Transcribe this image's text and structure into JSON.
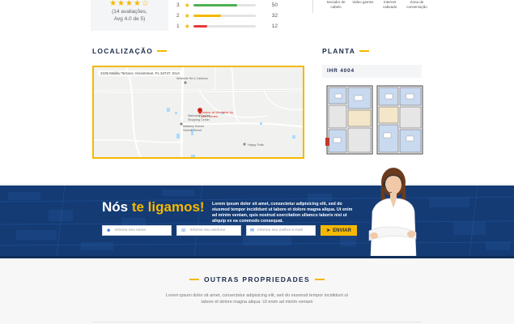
{
  "rating": {
    "stars": "★★★★☆",
    "count_text": "(14 avaliações,",
    "avg_text": "Avg 4.0 de 5)",
    "rows": [
      {
        "star_num": "3",
        "count": "50",
        "fill": 0.7,
        "color": "#4caf50"
      },
      {
        "star_num": "2",
        "count": "32",
        "fill": 0.45,
        "color": "#f5b800"
      },
      {
        "star_num": "1",
        "count": "12",
        "fill": 0.22,
        "color": "#e53935"
      }
    ]
  },
  "amenities": [
    {
      "label": "Secador de cabelo"
    },
    {
      "label": "Video games"
    },
    {
      "label": "Internet cabeado"
    },
    {
      "label": "Zona de conservação"
    }
  ],
  "localizacao": {
    "heading": "LOCALIZAÇÃO",
    "address": "2105 Malibu Terrace, Kissimmee, FL 34747, EUA",
    "pin_label": "Windsor at Westside by Patio Homes",
    "labels": [
      "Westside Rd & Calderon",
      "Walmarts Garden Shopping Center",
      "Mattamy Homes Visitors Resort",
      "Happy Trails"
    ]
  },
  "planta": {
    "heading": "PLANTA",
    "model": "IHR 4004"
  },
  "callback": {
    "title_prefix": "Nós ",
    "title_highlight": "te ligamos!",
    "description": "Lorem ipsum dolor sit amet, consectetur adipisicing elit, sed do eiusmod tempor incididunt ut labore et dolore magna aliqua. Ut enim ad minim veniam, quis nostrud exercitation ullamco laboris nisi ut aliquip ex ea commodo consequat.",
    "name_placeholder": "Informe seu nome",
    "phone_placeholder": "Informe seu telefone",
    "email_placeholder": "Informe seu melhor e-mail",
    "submit_label": "ENVIAR"
  },
  "outras": {
    "heading": "OUTRAS PROPRIEDADES",
    "description": "Lorem ipsum dolor sit amet, consectetur adipisicing elit, sed do eiusmod tempor incididunt ut labore et dolore magna aliqua. Ut enim ad minim veniam"
  },
  "colors": {
    "accent": "#f5b800",
    "navy": "#1c2a4b",
    "banner": "#143b74"
  }
}
